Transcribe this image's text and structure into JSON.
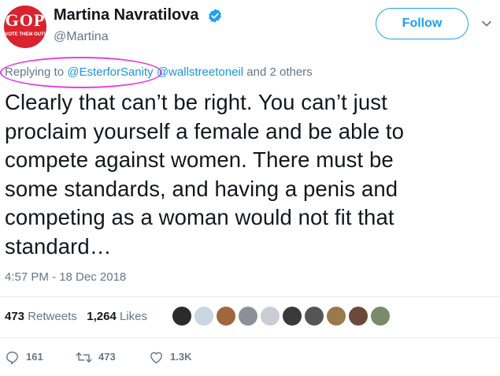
{
  "user": {
    "avatar_text": "GOP",
    "avatar_subtext": "VOTE THEM OUT!",
    "display_name": "Martina Navratilova",
    "handle": "@Martina"
  },
  "header": {
    "follow_label": "Follow"
  },
  "reply": {
    "prefix": "Replying to ",
    "mention_1": "@EsterforSanity",
    "mention_2": "@wallstreetoneil",
    "suffix": " and 2 others"
  },
  "tweet": {
    "lines": [
      "Clearly that can’t be right. You can’t just",
      "proclaim yourself a female and be able to",
      "compete against women. There must be",
      "some standards, and having a penis and",
      "competing as a woman would not fit that",
      "standard…"
    ],
    "timestamp": "4:57 PM - 18 Dec 2018"
  },
  "stats": {
    "retweets_count": "473",
    "retweets_label": "Retweets",
    "likes_count": "1,264",
    "likes_label": "Likes"
  },
  "likers": {
    "colors": [
      "#2b2b2b",
      "#c9d6e3",
      "#a0673f",
      "#8b9096",
      "#c8ced4",
      "#3a3a3a",
      "#555555",
      "#9a7a4a",
      "#6b4a3a",
      "#7a8a6a"
    ]
  },
  "actions": {
    "reply_count": "161",
    "retweet_count": "473",
    "like_count": "1.3K"
  },
  "colors": {
    "accent": "#1da1f2",
    "highlight": "#e040e0",
    "muted": "#657786"
  }
}
